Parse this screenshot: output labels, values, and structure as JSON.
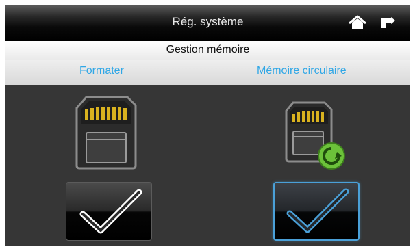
{
  "window": {
    "title": "Rég. système"
  },
  "header": {
    "subtitle": "Gestion mémoire"
  },
  "tabs": [
    {
      "label": "Formater"
    },
    {
      "label": "Mémoire circulaire"
    }
  ],
  "icons": {
    "home": "home-icon",
    "back": "back-arrow-icon",
    "sd_card": "sd-card-icon",
    "sd_card_circular": "sd-card-recycle-icon",
    "check": "checkmark-icon"
  },
  "colors": {
    "accent": "#30a7e6",
    "selected_border": "#4aa0d8",
    "recycle_green": "#6cc23a",
    "card_gold": "#d9b21f"
  },
  "selected_option": "Mémoire circulaire"
}
